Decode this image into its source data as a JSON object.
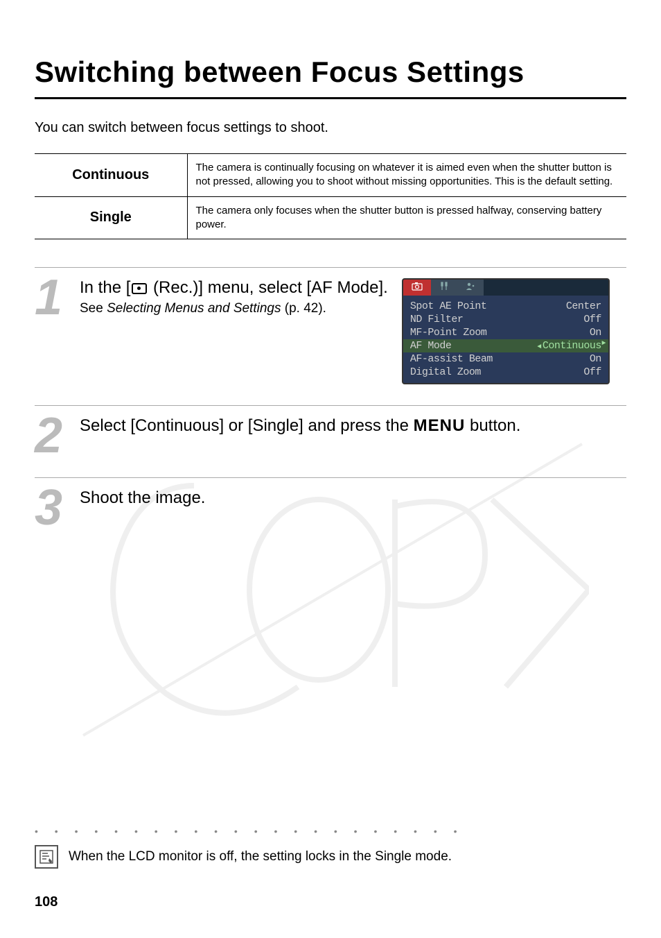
{
  "title": "Switching between Focus Settings",
  "intro": "You can switch between focus settings to shoot.",
  "table": {
    "rows": [
      {
        "label": "Continuous",
        "desc": "The camera is continually focusing on whatever it is aimed even when the shutter button is not pressed, allowing you to shoot without missing opportunities. This is the default setting."
      },
      {
        "label": "Single",
        "desc": "The camera only focuses when the shutter button is pressed halfway, conserving battery power."
      }
    ]
  },
  "steps": {
    "s1": {
      "num": "1",
      "heading_pre": "In the [",
      "heading_post": " (Rec.)] menu, select [AF Mode].",
      "sub_pre": "See ",
      "sub_em": "Selecting Menus and Settings",
      "sub_post": " (p. 42)."
    },
    "s2": {
      "num": "2",
      "heading_pre": "Select [Continuous] or [Single] and press the ",
      "menu_label": "MENU",
      "heading_post": " button."
    },
    "s3": {
      "num": "3",
      "heading": "Shoot the image."
    }
  },
  "camera_menu": {
    "items": [
      {
        "label": "Spot AE Point",
        "value": "Center",
        "selected": false
      },
      {
        "label": "ND Filter",
        "value": "Off",
        "selected": false
      },
      {
        "label": "MF-Point Zoom",
        "value": "On",
        "selected": false
      },
      {
        "label": "AF Mode",
        "value": "Continuous",
        "selected": true
      },
      {
        "label": "AF-assist Beam",
        "value": "On",
        "selected": false
      },
      {
        "label": "Digital Zoom",
        "value": "Off",
        "selected": false
      }
    ]
  },
  "info_note": "When the LCD monitor is off, the setting locks in the Single mode.",
  "page_number": "108"
}
